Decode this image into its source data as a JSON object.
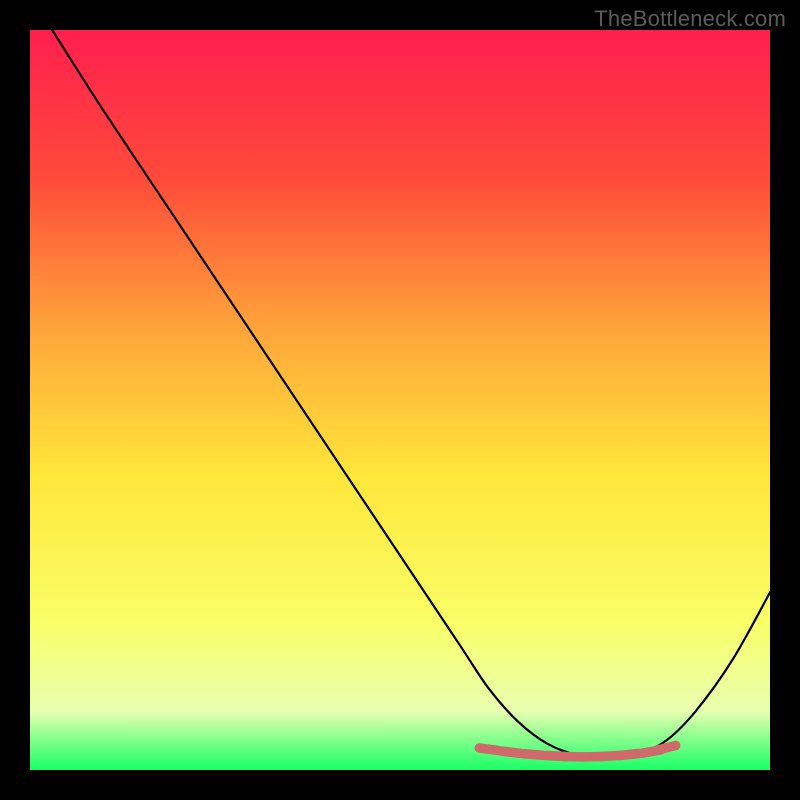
{
  "watermark": "TheBottleneck.com",
  "chart_data": {
    "type": "line",
    "title": "",
    "xlabel": "",
    "ylabel": "",
    "xlim": [
      0,
      100
    ],
    "ylim": [
      0,
      100
    ],
    "gradient_stops": [
      {
        "offset": 0,
        "color": "#ff1f4f"
      },
      {
        "offset": 20,
        "color": "#ff4a3a"
      },
      {
        "offset": 40,
        "color": "#ffa33a"
      },
      {
        "offset": 60,
        "color": "#ffe63a"
      },
      {
        "offset": 80,
        "color": "#f9ff66"
      },
      {
        "offset": 92,
        "color": "#e8ffb0"
      },
      {
        "offset": 100,
        "color": "#19ff66"
      }
    ],
    "series": [
      {
        "name": "curve",
        "type": "line",
        "color": "#000000",
        "width": 2.2,
        "x": [
          3,
          10,
          20,
          30,
          40,
          50,
          58,
          62,
          66,
          70,
          74,
          78,
          82,
          86,
          90,
          95,
          100
        ],
        "y": [
          100,
          89,
          74,
          59,
          44,
          29,
          17,
          11,
          6.5,
          3.5,
          2.0,
          1.5,
          2.0,
          4.0,
          8.0,
          15,
          24
        ]
      },
      {
        "name": "bottom-marks",
        "type": "scatter",
        "color": "#cf6a6a",
        "radius": 6,
        "shape": "pill",
        "x": [
          62,
          65,
          68,
          71,
          73.5,
          76,
          78.5,
          81,
          84,
          86
        ],
        "y": [
          2.8,
          2.4,
          2.1,
          1.9,
          1.8,
          1.8,
          1.9,
          2.1,
          2.5,
          3.0
        ]
      }
    ]
  }
}
